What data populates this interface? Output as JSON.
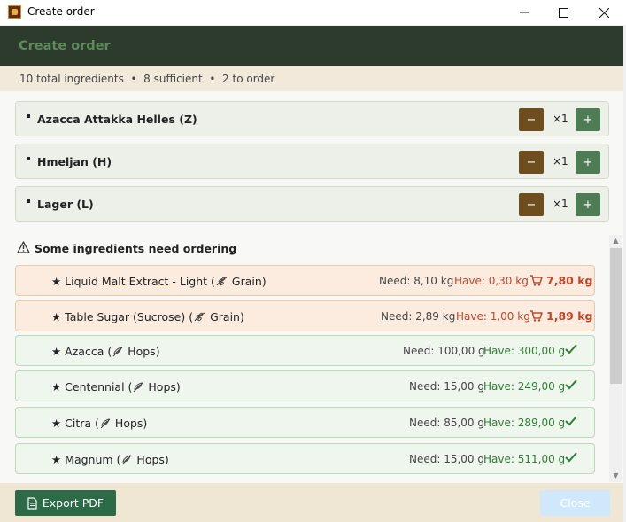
{
  "window": {
    "title": "Create order",
    "minimize": "—",
    "maximize": "☐",
    "close": "✕"
  },
  "header": {
    "title": "Create order"
  },
  "summary": "10 total ingredients  •  8 sufficient  •  2 to order",
  "recipes": [
    {
      "name": "Azacca Attakka Helles (Z)",
      "qty": "×1",
      "minus": "−",
      "plus": "+"
    },
    {
      "name": "Hmeljan (H)",
      "qty": "×1",
      "minus": "−",
      "plus": "+"
    },
    {
      "name": "Lager (L)",
      "qty": "×1",
      "minus": "−",
      "plus": "+"
    }
  ],
  "warning": {
    "text": "Some ingredients need ordering",
    "icon": "warning-icon"
  },
  "ingredients": [
    {
      "prefix": "★ Liquid Malt Extract - Light (",
      "type": "Grain",
      "suffix": ")",
      "need": "Need: 8,10 kg",
      "have": "Have: 0,30 kg",
      "order": "7,80 kg",
      "status": "low"
    },
    {
      "prefix": "★ Table Sugar (Sucrose) (",
      "type": "Grain",
      "suffix": ")",
      "need": "Need: 2,89 kg",
      "have": "Have: 1,00 kg",
      "order": "1,89 kg",
      "status": "low"
    },
    {
      "prefix": "★ Azacca (",
      "type": "Hops",
      "suffix": ")",
      "need": "Need: 100,00 g",
      "have": "Have: 300,00 g",
      "status": "ok"
    },
    {
      "prefix": "★ Centennial (",
      "type": "Hops",
      "suffix": ")",
      "need": "Need: 15,00 g",
      "have": "Have: 249,00 g",
      "status": "ok"
    },
    {
      "prefix": "★ Citra (",
      "type": "Hops",
      "suffix": ")",
      "need": "Need: 85,00 g",
      "have": "Have: 289,00 g",
      "status": "ok"
    },
    {
      "prefix": "★ Magnum (",
      "type": "Hops",
      "suffix": ")",
      "need": "Need: 15,00 g",
      "have": "Have: 511,00 g",
      "status": "ok"
    }
  ],
  "footer": {
    "export": "Export PDF",
    "close": "Close"
  },
  "colors": {
    "header_bg": "#2c3b2c",
    "header_text": "#5d8a5b",
    "accent_green": "#2c6a48",
    "minus_brown": "#6e4e1e",
    "warning_red": "#c0462a",
    "ok_green": "#2e7d32"
  }
}
